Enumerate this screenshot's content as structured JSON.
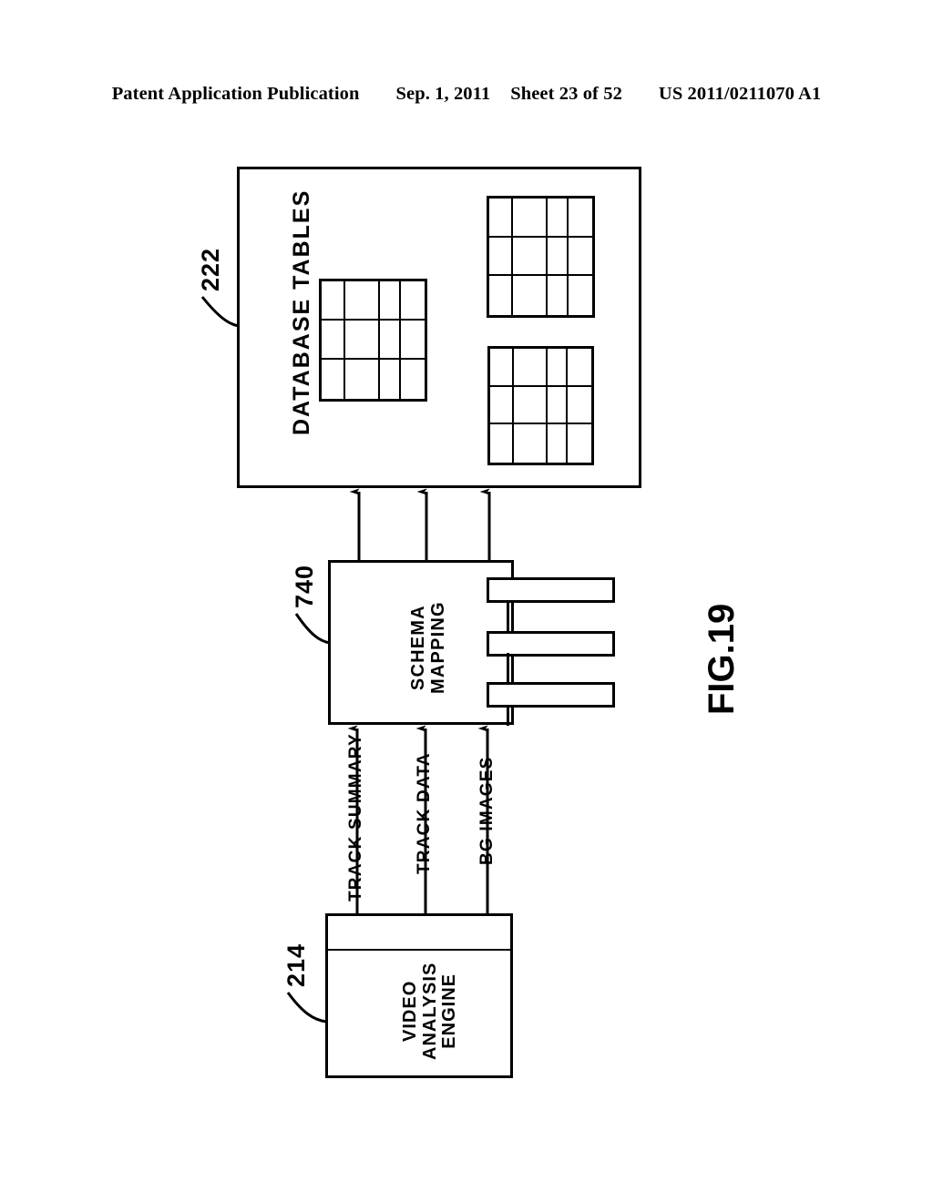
{
  "header": {
    "publication": "Patent Application Publication",
    "date": "Sep. 1, 2011",
    "sheet": "Sheet 23 of 52",
    "patent_number": "US 2011/0211070 A1"
  },
  "figure": {
    "label": "FIG.19",
    "blocks": [
      {
        "id": "database-tables",
        "title": "DATABASE TABLES",
        "ref": "222",
        "tables": [
          {
            "id": "table-a",
            "columns": 4,
            "rows": 3
          },
          {
            "id": "table-b",
            "columns": 4,
            "rows": 3
          },
          {
            "id": "table-c",
            "columns": 4,
            "rows": 3
          }
        ]
      },
      {
        "id": "schema-mapping",
        "title_line1": "SCHEMA",
        "title_line2": "MAPPING",
        "ref": "740",
        "bars": [
          {
            "id": "mapping-bar-1"
          },
          {
            "id": "mapping-bar-2"
          },
          {
            "id": "mapping-bar-3"
          }
        ]
      },
      {
        "id": "video-analysis-engine",
        "title_line1": "VIDEO",
        "title_line2": "ANALYSIS",
        "title_line3": "ENGINE",
        "ref": "214"
      }
    ],
    "flows": [
      {
        "id": "flow-track-summary",
        "label": "TRACK  SUMMARY",
        "from": "video-analysis-engine",
        "to": "schema-mapping"
      },
      {
        "id": "flow-track-data",
        "label": "TRACK  DATA",
        "from": "video-analysis-engine",
        "to": "schema-mapping"
      },
      {
        "id": "flow-bg-images",
        "label": "BG IMAGES",
        "from": "video-analysis-engine",
        "to": "schema-mapping"
      },
      {
        "id": "flow-schema-to-db-1",
        "label": "",
        "from": "schema-mapping",
        "to": "database-tables"
      },
      {
        "id": "flow-schema-to-db-2",
        "label": "",
        "from": "schema-mapping",
        "to": "database-tables"
      },
      {
        "id": "flow-schema-to-db-3",
        "label": "",
        "from": "schema-mapping",
        "to": "database-tables"
      }
    ]
  },
  "colors": {
    "ink": "#000000",
    "paper": "#ffffff"
  }
}
